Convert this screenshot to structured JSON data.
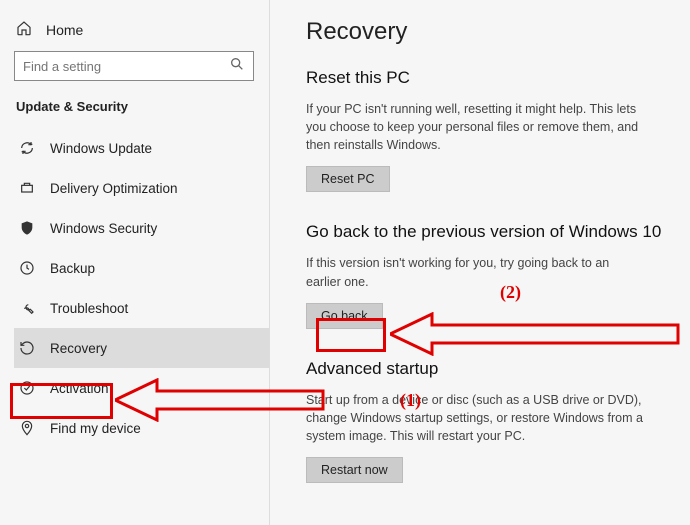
{
  "sidebar": {
    "home": "Home",
    "search_placeholder": "Find a setting",
    "category": "Update & Security",
    "items": [
      {
        "label": "Windows Update"
      },
      {
        "label": "Delivery Optimization"
      },
      {
        "label": "Windows Security"
      },
      {
        "label": "Backup"
      },
      {
        "label": "Troubleshoot"
      },
      {
        "label": "Recovery"
      },
      {
        "label": "Activation"
      },
      {
        "label": "Find my device"
      }
    ]
  },
  "main": {
    "title": "Recovery",
    "section1": {
      "heading": "Reset this PC",
      "body": "If your PC isn't running well, resetting it might help. This lets you choose to keep your personal files or remove them, and then reinstalls Windows.",
      "button": "Reset PC"
    },
    "section2": {
      "heading": "Go back to the previous version of Windows 10",
      "body": "If this version isn't working for you, try going back to an earlier one.",
      "button": "Go back"
    },
    "section3": {
      "heading": "Advanced startup",
      "body": "Start up from a device or disc (such as a USB drive or DVD), change Windows startup settings, or restore Windows from a system image. This will restart your PC.",
      "button": "Restart now"
    }
  },
  "annotations": {
    "label1": "(1)",
    "label2": "(2)"
  }
}
